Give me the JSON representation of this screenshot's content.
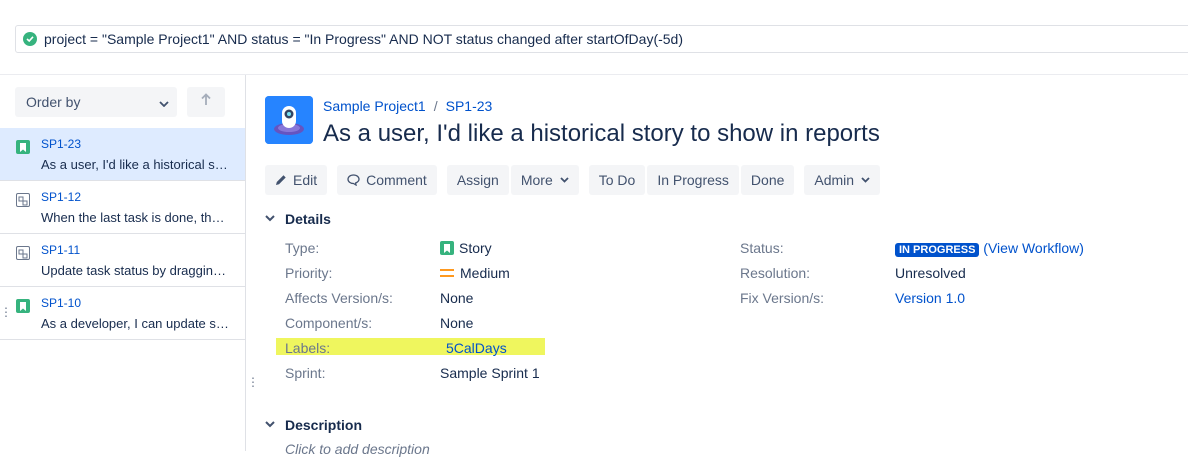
{
  "jql": {
    "query": "project = \"Sample Project1\" AND status = \"In Progress\" AND NOT status changed after startOfDay(-5d)"
  },
  "left_panel": {
    "order_by_label": "Order by",
    "sort_icon": "arrow-up-icon",
    "issues": [
      {
        "key": "SP1-23",
        "summary": "As a user, I'd like a historical story to show in reports",
        "type": "story",
        "selected": true
      },
      {
        "key": "SP1-12",
        "summary": "When the last task is done, the story can be closed",
        "type": "subtask",
        "selected": false
      },
      {
        "key": "SP1-11",
        "summary": "Update task status by dragging and dropping",
        "type": "subtask",
        "selected": false
      },
      {
        "key": "SP1-10",
        "summary": "As a developer, I can update story and task status",
        "type": "story",
        "selected": false
      }
    ]
  },
  "issue": {
    "project": "Sample Project1",
    "key": "SP1-23",
    "title": "As a user, I'd like a historical story to show in reports"
  },
  "toolbar": {
    "edit": "Edit",
    "comment": "Comment",
    "assign": "Assign",
    "more": "More",
    "todo": "To Do",
    "in_progress": "In Progress",
    "done": "Done",
    "admin": "Admin"
  },
  "details": {
    "heading": "Details",
    "type_label": "Type:",
    "type_value": "Story",
    "priority_label": "Priority:",
    "priority_value": "Medium",
    "affects_label": "Affects Version/s:",
    "affects_value": "None",
    "component_label": "Component/s:",
    "component_value": "None",
    "labels_label": "Labels:",
    "labels_value": "5CalDays",
    "sprint_label": "Sprint:",
    "sprint_value": "Sample Sprint 1",
    "status_label": "Status:",
    "status_value": "IN PROGRESS",
    "workflow_link": "(View Workflow)",
    "resolution_label": "Resolution:",
    "resolution_value": "Unresolved",
    "fix_label": "Fix Version/s:",
    "fix_value": "Version 1.0"
  },
  "description": {
    "heading": "Description",
    "placeholder": "Click to add description"
  },
  "colors": {
    "accent": "#0052cc",
    "story_green": "#36b37e",
    "priority_orange": "#ff991f",
    "highlight_yellow": "#ecf442"
  }
}
